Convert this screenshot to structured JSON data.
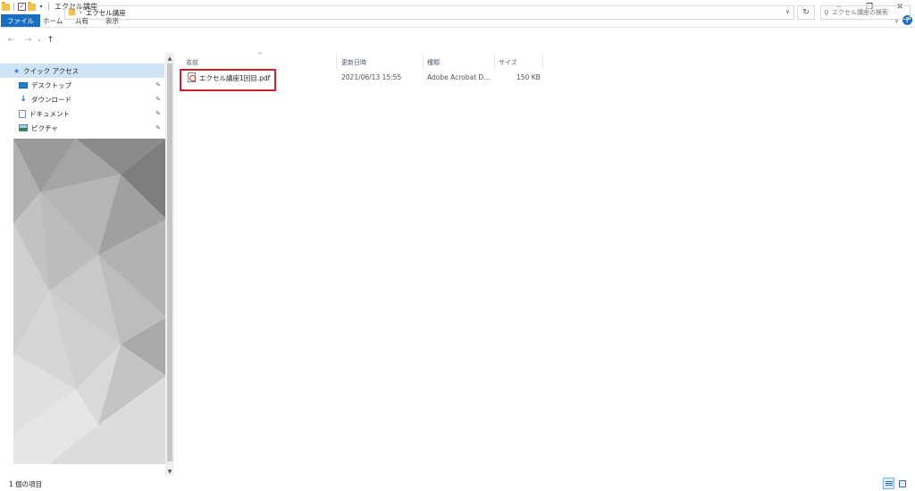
{
  "window": {
    "title": "エクセル講座",
    "controls": {
      "minimize": "─",
      "maximize": "❐",
      "close": "✕"
    }
  },
  "ribbon": {
    "tabs": [
      "ファイル",
      "ホーム",
      "共有",
      "表示"
    ],
    "help": "?"
  },
  "address": {
    "path": "エクセル講座",
    "search_placeholder": "エクセル講座の検索"
  },
  "nav": {
    "quick_access": "クイック アクセス",
    "items": [
      {
        "label": "デスクトップ",
        "icon": "desktop-icon"
      },
      {
        "label": "ダウンロード",
        "icon": "download-icon"
      },
      {
        "label": "ドキュメント",
        "icon": "document-icon"
      },
      {
        "label": "ピクチャ",
        "icon": "picture-icon"
      }
    ]
  },
  "columns": {
    "name": "名前",
    "modified": "更新日時",
    "type": "種類",
    "size": "サイズ"
  },
  "files": [
    {
      "name": "エクセル講座1回目.pdf",
      "modified": "2021/06/13 15:55",
      "type": "Adobe Acrobat D...",
      "size": "150 KB",
      "icon": "pdf-icon"
    }
  ],
  "status": {
    "item_count": "1 個の項目"
  },
  "colors": {
    "accent": "#1a6fc2",
    "selection": "#cfe4f7",
    "highlight": "#d21f2a"
  }
}
